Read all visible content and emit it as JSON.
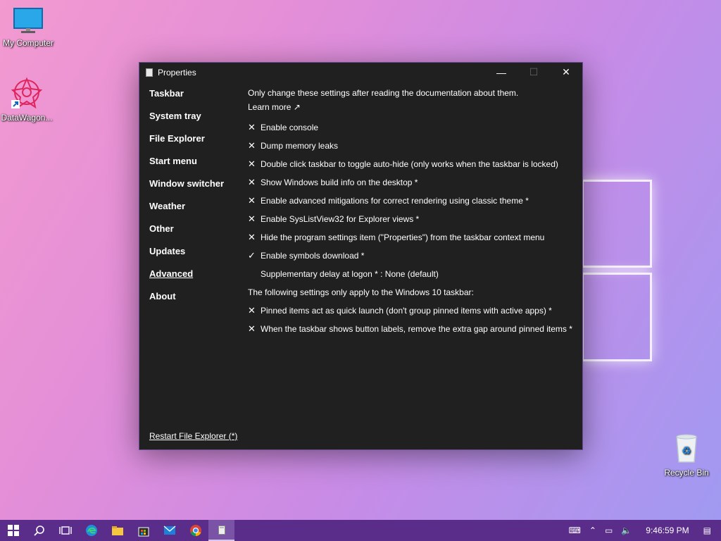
{
  "desktop": {
    "icons": [
      {
        "label": "My Computer",
        "icon": "monitor-icon"
      },
      {
        "label": "DataWagon...",
        "icon": "datawagon-icon"
      },
      {
        "label": "Recycle Bin",
        "icon": "recycle-bin-icon"
      }
    ]
  },
  "window": {
    "title": "Properties",
    "controls": {
      "minimize": "—",
      "maximize": "☐",
      "close": "✕"
    },
    "nav": [
      {
        "label": "Taskbar"
      },
      {
        "label": "System tray"
      },
      {
        "label": "File Explorer"
      },
      {
        "label": "Start menu"
      },
      {
        "label": "Window switcher"
      },
      {
        "label": "Weather"
      },
      {
        "label": "Other"
      },
      {
        "label": "Updates"
      },
      {
        "label": "Advanced",
        "active": true
      },
      {
        "label": "About"
      }
    ],
    "restart_link": "Restart File Explorer (*)",
    "content": {
      "intro": "Only change these settings after reading the documentation about them.",
      "learn_more": "Learn more ↗",
      "settings": [
        {
          "mark": "✕",
          "label": "Enable console"
        },
        {
          "mark": "✕",
          "label": "Dump memory leaks"
        },
        {
          "mark": "✕",
          "label": "Double click taskbar to toggle auto-hide (only works when the taskbar is locked)"
        },
        {
          "mark": "✕",
          "label": "Show Windows build info on the desktop *"
        },
        {
          "mark": "✕",
          "label": "Enable advanced mitigations for correct rendering using classic theme *"
        },
        {
          "mark": "✕",
          "label": "Enable SysListView32 for Explorer views *"
        },
        {
          "mark": "✕",
          "label": "Hide the program settings item (\"Properties\") from the taskbar context menu"
        },
        {
          "mark": "✓",
          "label": "Enable symbols download *"
        },
        {
          "mark": "",
          "label": "Supplementary delay at logon * : None (default)"
        }
      ],
      "section_label": "The following settings only apply to the Windows 10 taskbar:",
      "section_settings": [
        {
          "mark": "✕",
          "label": "Pinned items act as quick launch (don't group pinned items with active apps) *"
        },
        {
          "mark": "✕",
          "label": "When the taskbar shows button labels, remove the extra gap around pinned items *"
        }
      ]
    }
  },
  "taskbar": {
    "clock": "9:46:59 PM",
    "apps": [
      "start-icon",
      "search-icon",
      "task-view-icon",
      "edge-icon",
      "file-explorer-icon",
      "store-icon",
      "mail-icon",
      "chrome-icon",
      "properties-app-icon"
    ]
  }
}
